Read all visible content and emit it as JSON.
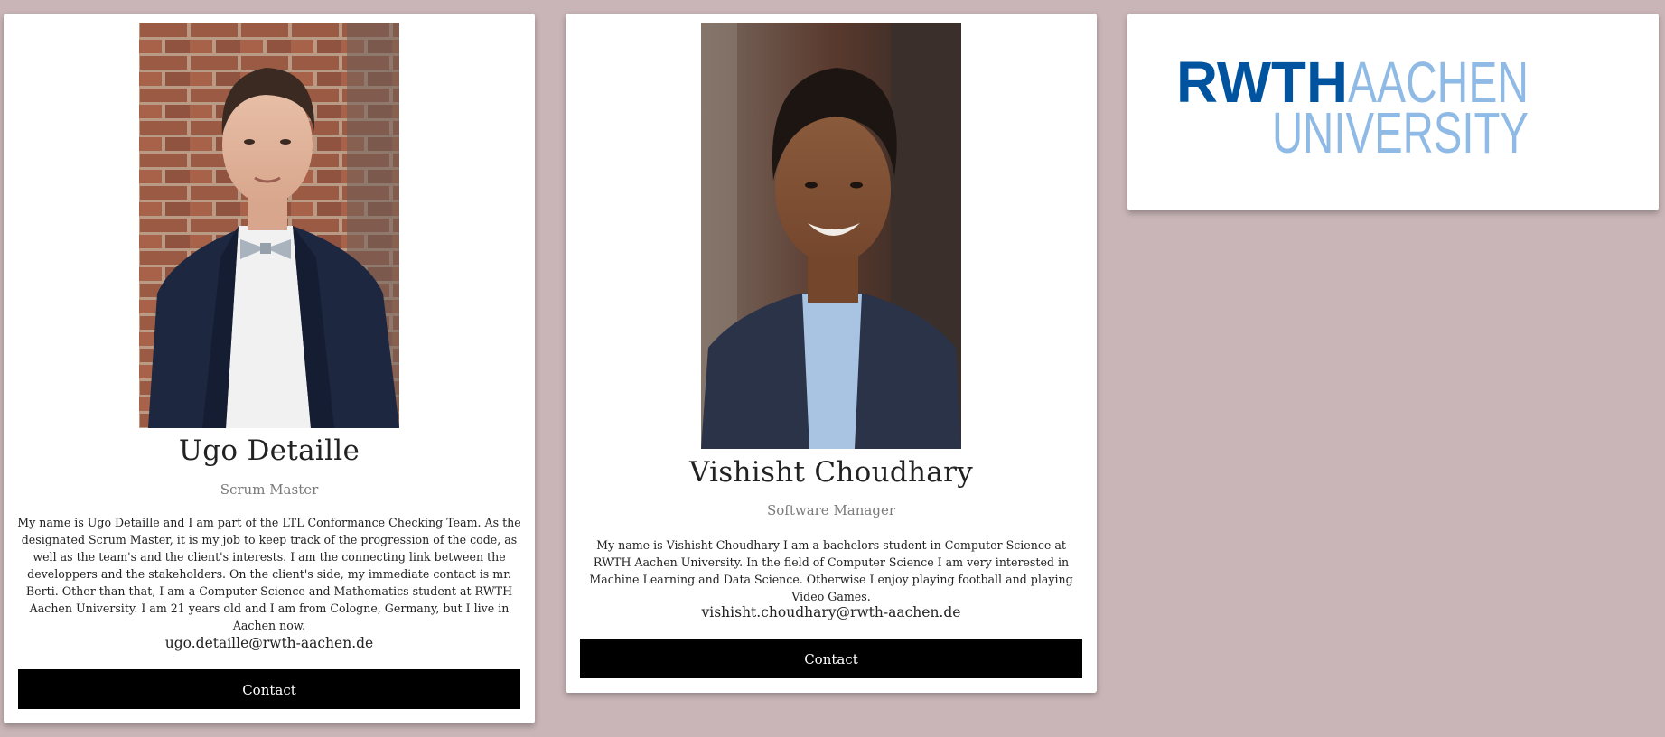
{
  "colors": {
    "page_background": "#c9b5b7",
    "card_background": "#ffffff",
    "button_background": "#000000",
    "button_text": "#ffffff",
    "role_text": "#7a7a7a",
    "rwth_dark_blue": "#00549f",
    "rwth_light_blue": "#8ebae5"
  },
  "members": [
    {
      "name": "Ugo Detaille",
      "role": "Scrum Master",
      "bio": "My name is Ugo Detaille and I am part of the LTL Conformance Checking Team. As the designated Scrum Master, it is my job to keep track of the progression of the code, as well as the team's and the client's interests. I am the connecting link between the developpers and the stakeholders. On the client's side, my immediate contact is mr. Berti. Other than that, I am a Computer Science and Mathematics student at RWTH Aachen University. I am 21 years old and I am from Cologne, Germany, but I live in Aachen now.",
      "email": "ugo.detaille@rwth-aachen.de",
      "contact_label": "Contact"
    },
    {
      "name": "Vishisht Choudhary",
      "role": "Software Manager",
      "bio": "My name is Vishisht Choudhary I am a bachelors student in Computer Science at RWTH Aachen University. In the field of Computer Science I am very interested in Machine Learning and Data Science. Otherwise I enjoy playing football and playing Video Games.",
      "email": "vishisht.choudhary@rwth-aachen.de",
      "contact_label": "Contact"
    }
  ],
  "logo": {
    "word_dark": "RWTH",
    "word_light_1": "AACHEN",
    "word_light_2": "UNIVERSITY"
  },
  "icons": {
    "photo_1": "portrait-photo",
    "photo_2": "portrait-photo",
    "logo": "rwth-logo"
  }
}
